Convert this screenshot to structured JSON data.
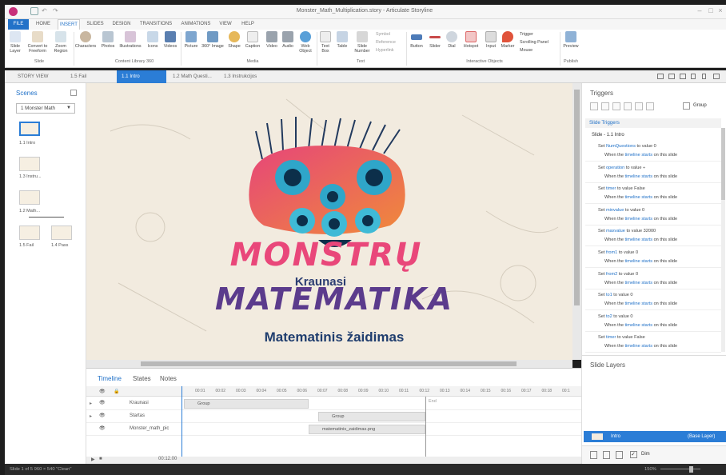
{
  "window": {
    "title": "Monster_Math_Multiplication.story - Articulate Storyline"
  },
  "ribbon_tabs": [
    "FILE",
    "HOME",
    "INSERT",
    "SLIDES",
    "DESIGN",
    "TRANSITIONS",
    "ANIMATIONS",
    "VIEW",
    "HELP"
  ],
  "ribbon": {
    "buttons": [
      "Slide Layer",
      "Convert to Freeform",
      "Zoom Region",
      "Characters",
      "Photos",
      "Illustrations",
      "Icons",
      "Videos",
      "Picture",
      "360° Image",
      "Shape",
      "Caption",
      "Video",
      "Audio",
      "Web Object",
      "Text Box",
      "Table",
      "Slide Number",
      "Button",
      "Slider",
      "Dial",
      "Hotspot",
      "Input",
      "Marker",
      "Preview"
    ],
    "small": [
      "Symbol",
      "Reference",
      "Hyperlink",
      "Trigger",
      "Scrolling Panel",
      "Mouse"
    ],
    "groups": [
      "Slide",
      "Content Library 360",
      "Media",
      "Text",
      "Interactive Objects",
      "Publish"
    ]
  },
  "story_tabs": [
    "STORY VIEW",
    "1.5 Fail",
    "1.1 Intro",
    "1.2 Math Questi...",
    "1.3 Instrukcijos"
  ],
  "scenes": {
    "title": "Scenes",
    "dropdown": "1 Monster Math",
    "thumbs": [
      "1.1 Intro",
      "1.3 Instru...",
      "1.2 Math...",
      "1.5 Fail",
      "1.4 Pass"
    ]
  },
  "stage": {
    "title1": "MONSTRŲ",
    "sub": "Kraunasi",
    "title2": "MATEMATIKA",
    "caption": "Matematinis žaidimas"
  },
  "timeline": {
    "tabs": [
      "Timeline",
      "States",
      "Notes"
    ],
    "ticks": [
      "00:01",
      "00:02",
      "00:03",
      "00:04",
      "00:05",
      "00:06",
      "00:07",
      "00:08",
      "00:09",
      "00:10",
      "00:11",
      "00:12",
      "00:13",
      "00:14",
      "00:15",
      "00:16",
      "00:17",
      "00:18",
      "00:1"
    ],
    "rows": [
      {
        "name": "Kraunasi",
        "bar": "Group"
      },
      {
        "name": "Startas",
        "bar": "Group"
      },
      {
        "name": "Monster_math_pic",
        "bar": "matematinis_zaidimas.png"
      }
    ],
    "end_label": "End",
    "time": "00:12.00"
  },
  "triggers": {
    "title": "Triggers",
    "group_label": "Group",
    "section": "Slide Triggers",
    "slide": "Slide - 1.1 Intro",
    "items": [
      {
        "pre": "Set ",
        "var": "NumQuestions",
        "post": " to value 0"
      },
      {
        "pre": "Set ",
        "var": "operation",
        "post": " to value ÷"
      },
      {
        "pre": "Set ",
        "var": "timer",
        "post": " to value False"
      },
      {
        "pre": "Set ",
        "var": "minvalue",
        "post": " to value 0"
      },
      {
        "pre": "Set ",
        "var": "maxvalue",
        "post": " to value 32000"
      },
      {
        "pre": "Set ",
        "var": "from1",
        "post": " to value 0"
      },
      {
        "pre": "Set ",
        "var": "from2",
        "post": " to value 0"
      },
      {
        "pre": "Set ",
        "var": "to1",
        "post": " to value 0"
      },
      {
        "pre": "Set ",
        "var": "to2",
        "post": " to value 0"
      },
      {
        "pre": "Set ",
        "var": "timer",
        "post": " to value False"
      }
    ],
    "when": "When the ",
    "when_link": "timeline starts",
    "when_post": " on this slide"
  },
  "layers": {
    "title": "Slide Layers",
    "base_name": "Intro",
    "base_tag": "(Base Layer)",
    "dim": "Dim"
  },
  "status": {
    "left": "Slide 1 of 5   960 × 540   \"Clean\"",
    "zoom": "150%"
  },
  "colors": {
    "accent": "#2b7dd6",
    "title_pink": "#e9477a",
    "title_purple": "#5b3b8c",
    "caption_navy": "#1f3d6e"
  }
}
